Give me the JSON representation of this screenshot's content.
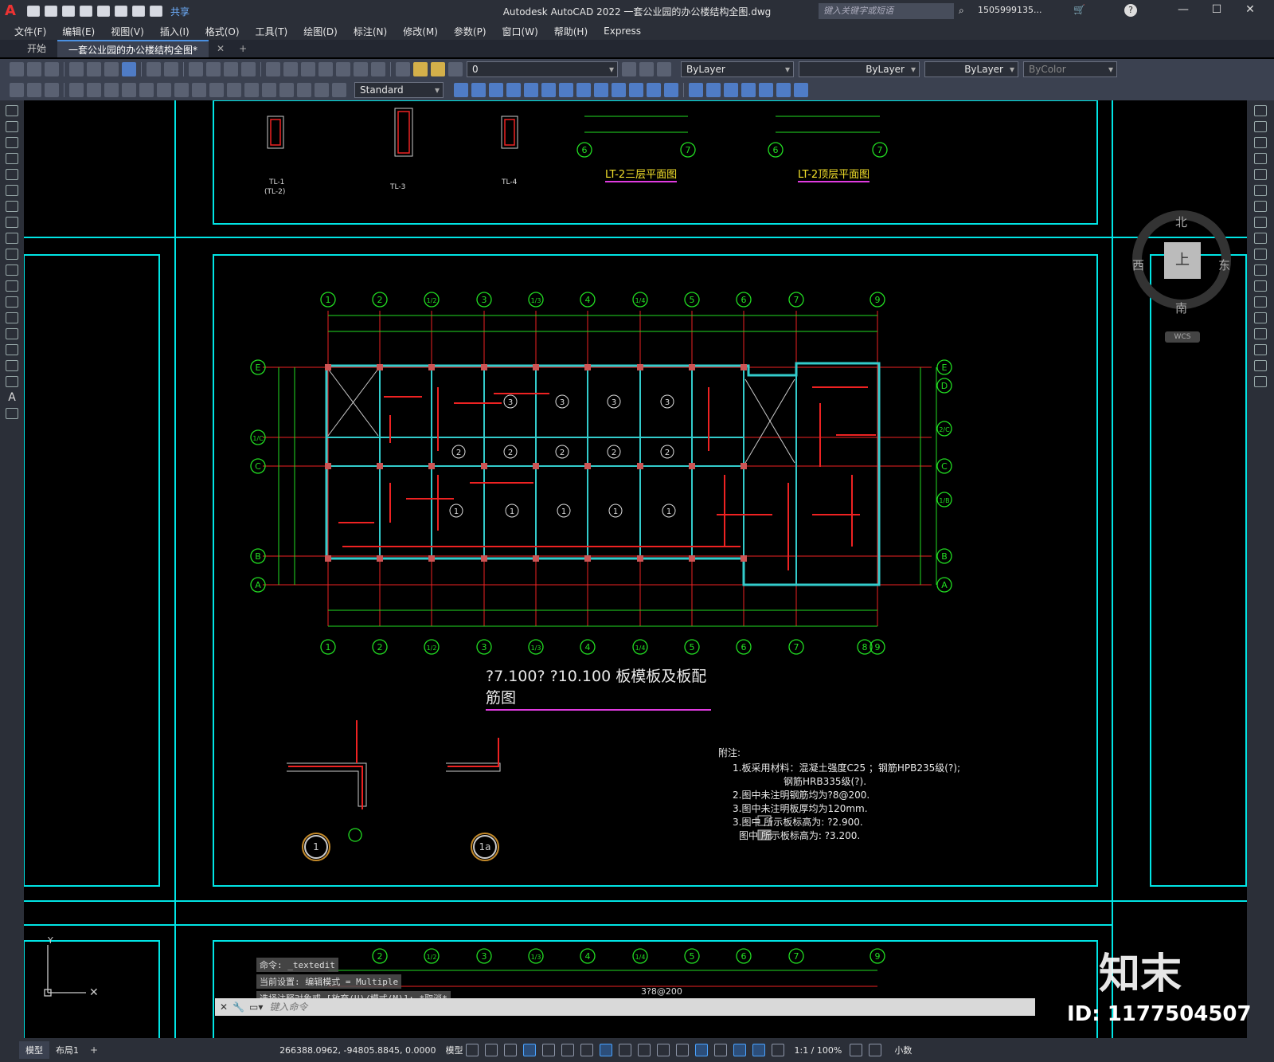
{
  "titlebar": {
    "app_letter": "A",
    "share_label": "共享",
    "title": "Autodesk AutoCAD 2022   一套公业园的办公楼结构全图.dwg",
    "search_placeholder": "键入关键字或短语",
    "user": "1505999135...",
    "help": "?"
  },
  "menu": [
    "文件(F)",
    "编辑(E)",
    "视图(V)",
    "插入(I)",
    "格式(O)",
    "工具(T)",
    "绘图(D)",
    "标注(N)",
    "修改(M)",
    "参数(P)",
    "窗口(W)",
    "帮助(H)",
    "Express"
  ],
  "doc_tabs": [
    "开始",
    "一套公业园的办公楼结构全图*"
  ],
  "toolbar": {
    "layer_value": "0",
    "text_style": "Standard",
    "color": "ByLayer",
    "linetype": "ByLayer",
    "lineweight": "ByLayer",
    "plotstyle": "ByColor"
  },
  "viewcube": {
    "north": "北",
    "south": "南",
    "east": "东",
    "west": "西",
    "top": "上",
    "wcs": "WCS"
  },
  "drawing": {
    "main_title": "?7.100?  ?10.100  板模板及板配筋图",
    "top_title_1": "LT-2三层平面图",
    "top_title_2": "LT-2顶层平面图",
    "beam_labels": [
      "TL-1",
      "(TL-2)",
      "TL-3",
      "TL-4"
    ],
    "axis_top": [
      "1",
      "2",
      "1/2",
      "3",
      "1/3",
      "4",
      "1/4",
      "5",
      "6",
      "7",
      "9"
    ],
    "axis_bottom": [
      "1",
      "2",
      "1/2",
      "3",
      "1/3",
      "4",
      "1/4",
      "5",
      "6",
      "7",
      "8",
      "9"
    ],
    "axis_left": [
      "E",
      "1/C",
      "C",
      "B",
      "A"
    ],
    "axis_right": [
      "E",
      "D",
      "2/C",
      "C",
      "1/B",
      "B",
      "A"
    ],
    "notes_title": "附注:",
    "notes": [
      "1.板采用材料：混凝土强度C25 ；钢筋HPB235级(?);",
      "钢筋HRB335级(?).",
      "2.图中未注明钢筋均为?8@200.",
      "3.图中未注明板厚均为120mm.",
      "3.图中        所示板标高为: ?2.900.",
      "图中        所示板标高为: ?3.200."
    ],
    "detail_1": "1",
    "detail_1a": "1a",
    "bottom_label": "3?8@200"
  },
  "command": {
    "history": [
      "命令: _textedit",
      "当前设置: 编辑模式 = Multiple",
      "选择注释对象或 [放弃(U)/模式(M)]: *取消*"
    ],
    "placeholder": "键入命令"
  },
  "status": {
    "tabs": [
      "模型",
      "布局1"
    ],
    "coords": "266388.0962, -94805.8845, 0.0000",
    "mode": "模型",
    "scale": "1:1 / 100%",
    "units": "小数"
  },
  "watermark": {
    "logo": "知末",
    "id": "ID: 1177504507"
  }
}
